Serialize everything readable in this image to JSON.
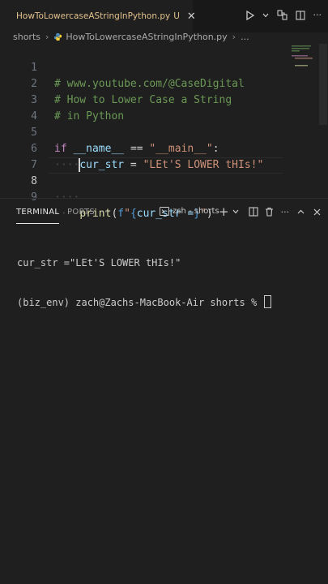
{
  "tab": {
    "file_name": "HowToLowercaseAStringInPython.py",
    "modified_marker": "U",
    "close_glyph": "✕",
    "file_icon": "python-file-icon"
  },
  "breadcrumb": {
    "folder": "shorts",
    "file": "HowToLowercaseAStringInPython.py",
    "more": "..."
  },
  "editor": {
    "active_line": "8",
    "lines": [
      {
        "number": "1",
        "text": "# www.youtube.com/@CaseDigital"
      },
      {
        "number": "2",
        "text": "# How to Lower Case a String"
      },
      {
        "number": "3",
        "text": "# in Python"
      },
      {
        "number": "4",
        "text": ""
      },
      {
        "number": "5",
        "text": "if __name__ == \"__main__\":"
      },
      {
        "number": "6",
        "text": "cur_str = \"LEt'S LOWER tHIs!\""
      },
      {
        "number": "7",
        "text": ""
      },
      {
        "number": "8",
        "text": ""
      },
      {
        "number": "9",
        "text": "print(f\"{cur_str =}\")"
      }
    ],
    "tokens": {
      "l1": "# www.youtube.com/@CaseDigital",
      "l2": "# How to Lower Case a String",
      "l3": "# in Python",
      "if_kw": "if",
      "dunder_name": "__name__",
      "eqeq": "==",
      "main_str": "\"__main__\"",
      "colon": ":",
      "indent_dots": "····",
      "var_cur_str": "cur_str",
      "assign": " = ",
      "value_str": "\"LEt'S LOWER tHIs!\"",
      "print_fn": "print",
      "open_paren": "(",
      "fprefix": "f",
      "fstr_open": "\"",
      "fbrace_open": "{",
      "fexpr": "cur_str =",
      "fbrace_close": "}",
      "fstr_close": "\"",
      "close_paren": ")"
    }
  },
  "panel": {
    "tabs": [
      {
        "label": "TERMINAL",
        "active": true
      },
      {
        "label": "PORTS",
        "active": false
      }
    ],
    "more": "···",
    "shell_name": "zsh - shorts",
    "terminal_lines": [
      "cur_str =\"LEt'S LOWER tHIs!\"",
      "(biz_env) zach@Zachs-MacBook-Air shorts % "
    ]
  },
  "colors": {
    "background": "#1f1f1f",
    "comment": "#6a9955",
    "keyword": "#c586c0",
    "variable": "#9cdcfe",
    "string": "#ce9178",
    "function": "#dcdcaa",
    "modified_tab": "#e2c08d"
  }
}
